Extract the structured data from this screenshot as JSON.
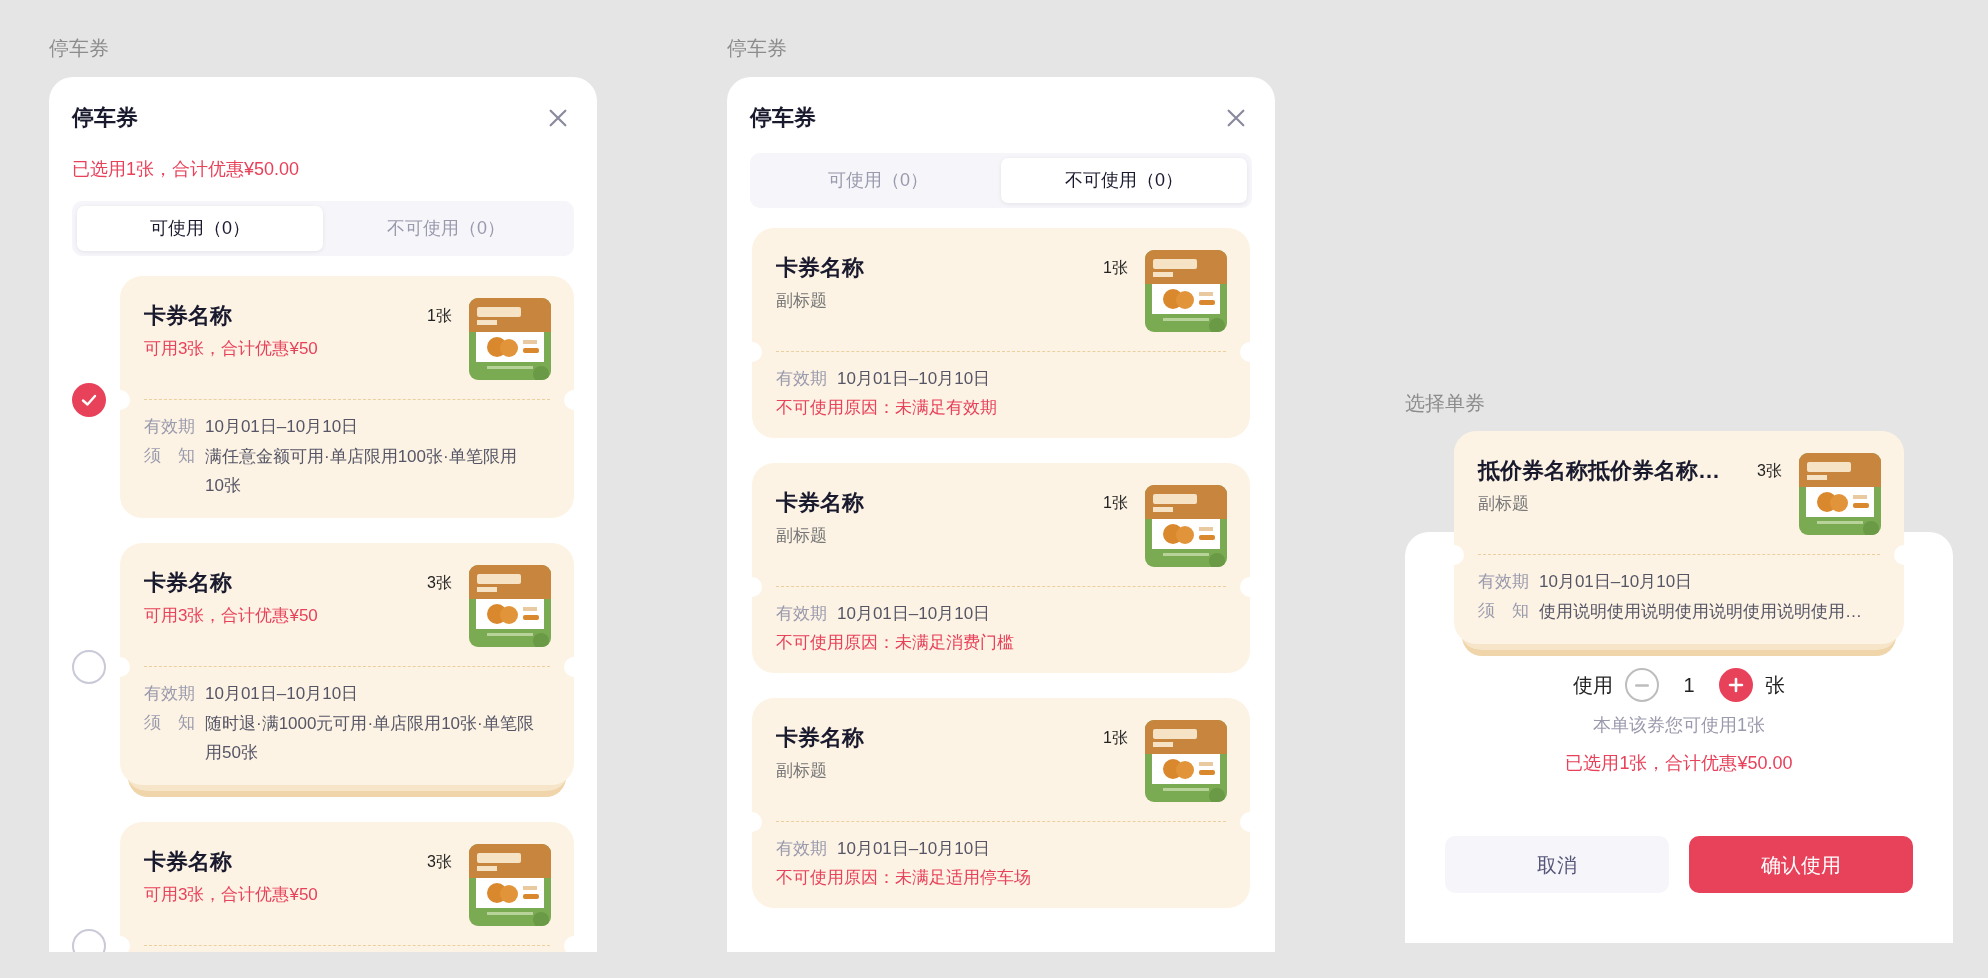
{
  "sections": [
    {
      "kind": "available",
      "caption": "停车券",
      "title": "停车券",
      "summary": "已选用1张，合计优惠¥50.00",
      "tabs": [
        {
          "label": "可使用（0）",
          "selected": true
        },
        {
          "label": "不可使用（0）",
          "selected": false
        }
      ],
      "vouchers": [
        {
          "name": "卡券名称",
          "subtitle": "可用3张，合计优惠¥50",
          "count": "1张",
          "checked": true,
          "stacked": false,
          "validity_label": "有效期",
          "validity": "10月01日–10月10日",
          "notice_label": "须知",
          "notice": "满任意金额可用·单店限用100张·单笔限用10张"
        },
        {
          "name": "卡券名称",
          "subtitle": "可用3张，合计优惠¥50",
          "count": "3张",
          "checked": false,
          "stacked": true,
          "validity_label": "有效期",
          "validity": "10月01日–10月10日",
          "notice_label": "须知",
          "notice": "随时退·满1000元可用·单店限用10张·单笔限用50张"
        },
        {
          "name": "卡券名称",
          "subtitle": "可用3张，合计优惠¥50",
          "count": "3张",
          "checked": false
        }
      ]
    },
    {
      "kind": "unavailable",
      "caption": "停车券",
      "title": "停车券",
      "tabs": [
        {
          "label": "可使用（0）",
          "selected": false
        },
        {
          "label": "不可使用（0）",
          "selected": true
        }
      ],
      "vouchers": [
        {
          "name": "卡券名称",
          "subtitle": "副标题",
          "count": "1张",
          "stacked": false,
          "validity_label": "有效期",
          "validity": "10月01日–10月10日",
          "reason": "不可使用原因：未满足有效期"
        },
        {
          "name": "卡券名称",
          "subtitle": "副标题",
          "count": "1张",
          "stacked": false,
          "validity_label": "有效期",
          "validity": "10月01日–10月10日",
          "reason": "不可使用原因：未满足消费门槛"
        },
        {
          "name": "卡券名称",
          "subtitle": "副标题",
          "count": "1张",
          "stacked": false,
          "validity_label": "有效期",
          "validity": "10月01日–10月10日",
          "reason": "不可使用原因：未满足适用停车场"
        }
      ]
    },
    {
      "kind": "single",
      "caption": "选择单券",
      "voucher": {
        "name": "抵价券名称抵价券名称…",
        "subtitle": "副标题",
        "count": "3张",
        "stacked": true,
        "validity_label": "有效期",
        "validity": "10月01日–10月10日",
        "notice_label": "须知",
        "notice": "使用说明使用说明使用说明使用说明使用…"
      },
      "stepper": {
        "label": "使用",
        "value": "1",
        "unit": "张",
        "minus_disabled": true,
        "plus_disabled": false
      },
      "hint": "本单该券您可使用1张",
      "summary": "已选用1张，合计优惠¥50.00",
      "buttons": [
        {
          "label": "取消",
          "kind": "secondary"
        },
        {
          "label": "确认使用",
          "kind": "primary"
        }
      ]
    }
  ]
}
